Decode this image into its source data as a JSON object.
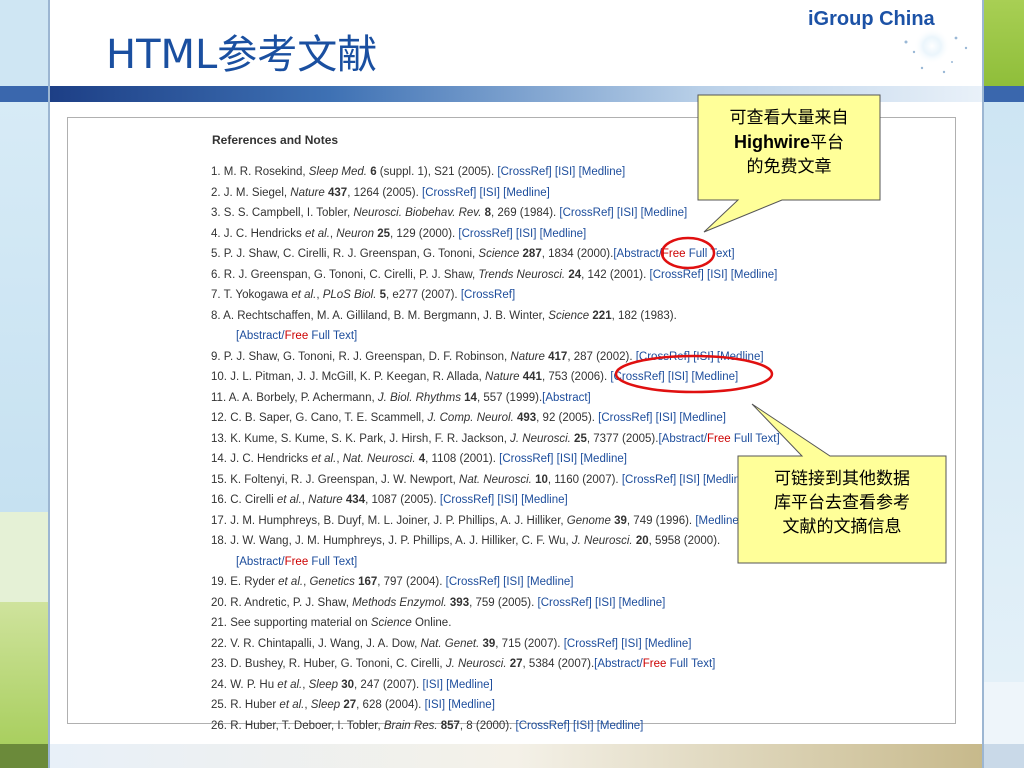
{
  "slide": {
    "title": "HTML参考文献",
    "brand": "iGroup China",
    "colors": {
      "title": "#1a4fa0",
      "brand": "#1c52a6",
      "link": "#1d4d9c",
      "free": "#cc0000",
      "callout_fill": "#ffff99",
      "annotation_red": "#e01010"
    }
  },
  "references": {
    "heading": "References and Notes",
    "items": [
      {
        "num": "1.",
        "authors": "M. R. Rosekind, ",
        "journal": "Sleep Med.",
        "vol": "6",
        "rest": " (suppl. 1), S21 (2005). ",
        "links": "[CrossRef] [ISI] [Medline]"
      },
      {
        "num": "2.",
        "authors": "J. M. Siegel, ",
        "journal": "Nature",
        "vol": "437",
        "rest": ", 1264 (2005). ",
        "links": "[CrossRef] [ISI] [Medline]"
      },
      {
        "num": "3.",
        "authors": "S. S. Campbell, I. Tobler, ",
        "journal": "Neurosci. Biobehav. Rev.",
        "vol": "8",
        "rest": ", 269 (1984). ",
        "links": "[CrossRef] [ISI] [Medline]"
      },
      {
        "num": "4.",
        "authors": "J. C. Hendricks ",
        "etal": "et al.",
        "authors2": ", ",
        "journal": "Neuron",
        "vol": "25",
        "rest": ", 129 (2000). ",
        "links": "[CrossRef] [ISI] [Medline]"
      },
      {
        "num": "5.",
        "authors": "P. J. Shaw, C. Cirelli, R. J. Greenspan, G. Tononi, ",
        "journal": "Science",
        "vol": "287",
        "rest": ", 1834 (2000).",
        "links_a": "[Abstract/",
        "links_free": "Free",
        "links_b": " Full Text]"
      },
      {
        "num": "6.",
        "authors": "R. J. Greenspan, G. Tononi, C. Cirelli, P. J. Shaw, ",
        "journal": "Trends Neurosci.",
        "vol": "24",
        "rest": ", 142 (2001). ",
        "links": "[CrossRef] [ISI] [Medline]"
      },
      {
        "num": "7.",
        "authors": "T. Yokogawa ",
        "etal": "et al.",
        "authors2": ", ",
        "journal": "PLoS Biol.",
        "vol": "5",
        "rest": ", e277 (2007). ",
        "links": "[CrossRef]"
      },
      {
        "num": "8.",
        "authors": "A. Rechtschaffen, M. A. Gilliland, B. M. Bergmann, J. B. Winter, ",
        "journal": "Science",
        "vol": "221",
        "rest": ", 182 (1983).",
        "cont_a": "[Abstract/",
        "cont_free": "Free",
        "cont_b": " Full Text]"
      },
      {
        "num": "9.",
        "authors": "P. J. Shaw, G. Tononi, R. J. Greenspan, D. F. Robinson, ",
        "journal": "Nature",
        "vol": "417",
        "rest": ", 287 (2002). ",
        "links": "[CrossRef] [ISI] [Medline]"
      },
      {
        "num": "10.",
        "authors": "J. L. Pitman, J. J. McGill, K. P. Keegan, R. Allada, ",
        "journal": "Nature",
        "vol": "441",
        "rest": ", 753 (2006). ",
        "links": "[CrossRef] [ISI] [Medline]"
      },
      {
        "num": "11.",
        "authors": "A. A. Borbely, P. Achermann, ",
        "journal": "J. Biol. Rhythms",
        "vol": "14",
        "rest": ", 557 (1999).",
        "links": "[Abstract]"
      },
      {
        "num": "12.",
        "authors": "C. B. Saper, G. Cano, T. E. Scammell, ",
        "journal": "J. Comp. Neurol.",
        "vol": "493",
        "rest": ", 92 (2005). ",
        "links": "[CrossRef] [ISI] [Medline]"
      },
      {
        "num": "13.",
        "authors": "K. Kume, S. Kume, S. K. Park, J. Hirsh, F. R. Jackson, ",
        "journal": "J. Neurosci.",
        "vol": "25",
        "rest": ", 7377 (2005).",
        "links_a": "[Abstract/",
        "links_free": "Free",
        "links_b": " Full Text]"
      },
      {
        "num": "14.",
        "authors": "J. C. Hendricks ",
        "etal": "et al.",
        "authors2": ", ",
        "journal": "Nat. Neurosci.",
        "vol": "4",
        "rest": ", 1108 (2001). ",
        "links": "[CrossRef] [ISI] [Medline]"
      },
      {
        "num": "15.",
        "authors": "K. Foltenyi, R. J. Greenspan, J. W. Newport, ",
        "journal": "Nat. Neurosci.",
        "vol": "10",
        "rest": ", 1160 (2007). ",
        "links": "[CrossRef] [ISI] [Medline]"
      },
      {
        "num": "16.",
        "authors": "C. Cirelli ",
        "etal": "et al.",
        "authors2": ", ",
        "journal": "Nature",
        "vol": "434",
        "rest": ", 1087 (2005). ",
        "links": "[CrossRef] [ISI] [Medline]"
      },
      {
        "num": "17.",
        "authors": "J. M. Humphreys, B. Duyf, M. L. Joiner, J. P. Phillips, A. J. Hilliker, ",
        "journal": "Genome",
        "vol": "39",
        "rest": ", 749 (1996). ",
        "links": "[Medline]"
      },
      {
        "num": "18.",
        "authors": "J. W. Wang, J. M. Humphreys, J. P. Phillips, A. J. Hilliker, C. F. Wu, ",
        "journal": "J. Neurosci.",
        "vol": "20",
        "rest": ", 5958 (2000).",
        "cont_a": "[Abstract/",
        "cont_free": "Free",
        "cont_b": " Full Text]"
      },
      {
        "num": "19.",
        "authors": "E. Ryder ",
        "etal": "et al.",
        "authors2": ", ",
        "journal": "Genetics",
        "vol": "167",
        "rest": ", 797 (2004). ",
        "links": "[CrossRef] [ISI] [Medline]"
      },
      {
        "num": "20.",
        "authors": "R. Andretic, P. J. Shaw, ",
        "journal": "Methods Enzymol.",
        "vol": "393",
        "rest": ", 759 (2005). ",
        "links": "[CrossRef] [ISI] [Medline]"
      },
      {
        "num": "21.",
        "authors": "See supporting material on ",
        "journal": "Science",
        "rest": " Online."
      },
      {
        "num": "22.",
        "authors": "V. R. Chintapalli, J. Wang, J. A. Dow, ",
        "journal": "Nat. Genet.",
        "vol": "39",
        "rest": ", 715 (2007). ",
        "links": "[CrossRef] [ISI] [Medline]"
      },
      {
        "num": "23.",
        "authors": "D. Bushey, R. Huber, G. Tononi, C. Cirelli, ",
        "journal": "J. Neurosci.",
        "vol": "27",
        "rest": ", 5384 (2007).",
        "links_a": "[Abstract/",
        "links_free": "Free",
        "links_b": " Full Text]"
      },
      {
        "num": "24.",
        "authors": "W. P. Hu ",
        "etal": "et al.",
        "authors2": ", ",
        "journal": "Sleep",
        "vol": "30",
        "rest": ", 247 (2007). ",
        "links": "[ISI] [Medline]"
      },
      {
        "num": "25.",
        "authors": "R. Huber ",
        "etal": "et al.",
        "authors2": ", ",
        "journal": "Sleep",
        "vol": "27",
        "rest": ", 628 (2004). ",
        "links": "[ISI] [Medline]"
      },
      {
        "num": "26.",
        "authors": "R. Huber, T. Deboer, I. Tobler, ",
        "journal": "Brain Res.",
        "vol": "857",
        "rest": ", 8 (2000). ",
        "links": "[CrossRef] [ISI] [Medline]"
      }
    ]
  },
  "callouts": {
    "top": {
      "line1": "可查看大量来自",
      "line2_bold": "Highwire",
      "line2_rest": "平台",
      "line3": "的免费文章"
    },
    "bottom": {
      "line1": "可链接到其他数据",
      "line2": "库平台去查看参考",
      "line3": "文献的文摘信息"
    }
  }
}
